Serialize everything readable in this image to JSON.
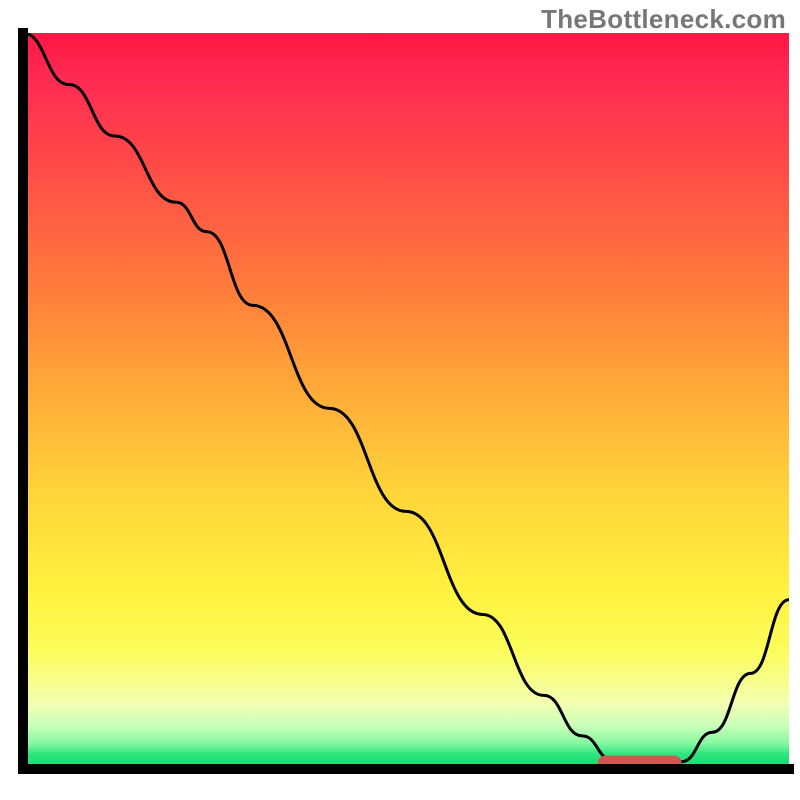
{
  "watermark": "TheBottleneck.com",
  "colors": {
    "gradient_top": "#ff1744",
    "gradient_bottom": "#13d96d",
    "axis": "#000000",
    "curve": "#000000",
    "marker": "#cf584f",
    "watermark": "#777777"
  },
  "chart_data": {
    "type": "line",
    "title": "",
    "xlabel": "",
    "ylabel": "",
    "xlim": [
      0,
      100
    ],
    "ylim": [
      0,
      100
    ],
    "x": [
      0,
      6,
      12,
      20,
      24,
      30,
      40,
      50,
      60,
      68,
      73,
      77,
      82,
      86,
      90,
      95,
      100
    ],
    "values": [
      100,
      93,
      86,
      77,
      73,
      63,
      49,
      35,
      21,
      10,
      4.5,
      1.2,
      0.5,
      1.0,
      5,
      13,
      23
    ],
    "annotations": [
      {
        "label": "marker",
        "x_start": 76,
        "x_end": 85,
        "y": 0.8
      }
    ]
  }
}
